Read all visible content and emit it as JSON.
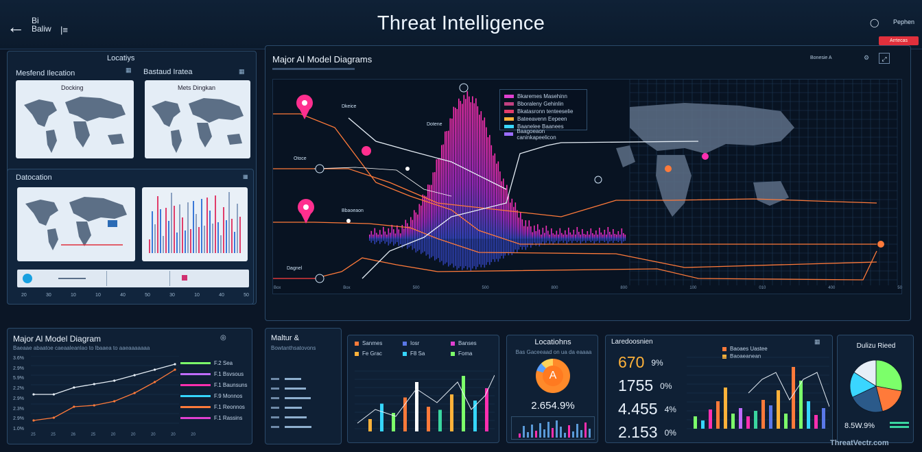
{
  "header": {
    "logo_line1": "Bi",
    "logo_line2": "Baliw",
    "title": "Threat Intelligence",
    "right_label": "Pephen",
    "badge": "Arrtecas"
  },
  "left": {
    "section_title": "Locatiys",
    "card1_title": "Mesfend Ilecation",
    "card1_map_label": "Docking",
    "card2_title": "Bastaud Iratea",
    "card2_map_label": "Mets Dingkan",
    "dislocation_title": "Datocation",
    "timeline": [
      "20",
      "30",
      "10",
      "10",
      "40",
      "50",
      "30",
      "10",
      "40",
      "50"
    ]
  },
  "main": {
    "title": "Major Al Model Diagrams",
    "controls": "Bonesie A",
    "node_labels": [
      "Dkeice",
      "Otoce",
      "Dotene",
      "Bbaoeaon",
      "Dagnel"
    ],
    "legend": [
      "Bkaremes Masehinn",
      "Bboraleny Gehinlin",
      "Bkatasronn tenteeselie",
      "Bateeavenn Eepeen",
      "Baanelee Baanees",
      "Baagoeaon caninkapeelicon"
    ]
  },
  "bottom": {
    "p1_title": "Major Al Model Diagram",
    "p1_subtitle": "Baeaae abaatoe caeaaleanlao to lbaaea to aaeaaaaaaa",
    "p1_y_ticks": [
      "3.6%",
      "2.9%",
      "5.9%",
      "2.2%",
      "2.9%",
      "2.3%",
      "2.9%",
      "1.0%"
    ],
    "p1_legend": [
      "F.2 Sea",
      "F.1 Bsvsous",
      "F.1 Baunsuns",
      "F.9 Monnos",
      "F.1 Reonnos",
      "F.1 Rassins"
    ],
    "p1_x_ticks": [
      "25",
      "25",
      "26",
      "25",
      "20",
      "20",
      "20",
      "20",
      "20"
    ],
    "p2_title": "Maltur &",
    "p2_subtitle": "Bowtanthsatovons",
    "p3_legend": [
      "Sanmes",
      "Iosr",
      "Banses",
      "Fe Grac",
      "F8 Sa",
      "Foma"
    ],
    "p4_title": "Locatiohns",
    "p4_subtitle": "Bas Gaceeaad on ua da eaaaa",
    "p4_value": "2.654.9%",
    "p4_pie_letter": "A",
    "p5_title": "Laredoosnien",
    "p5_numbers": [
      "670",
      "1755",
      "4.455",
      "2.153"
    ],
    "p5_small": [
      "9%",
      "0%",
      "4%",
      "0%"
    ],
    "p5_legend": [
      "Baoaes Uastee",
      "Baoaeanean"
    ],
    "p6_title": "Dulizu Rieed",
    "p6_value": "8.5W.9%"
  },
  "watermark": "ThreatVectr.com",
  "colors": {
    "accent_pink": "#ff2fb0",
    "accent_orange": "#ff7a3a",
    "accent_cyan": "#36d6ff",
    "accent_green": "#7cff6a",
    "badge_red": "#e0303c"
  },
  "chart_data": [
    {
      "type": "line",
      "title": "Major Al Model Diagram",
      "series": [
        {
          "values": [
            5,
            5,
            6,
            6.5,
            7,
            7.8,
            8.6,
            9.4
          ]
        },
        {
          "values": [
            1.2,
            1.6,
            3.2,
            3.4,
            4.0,
            5.2,
            6.8,
            8.6
          ]
        }
      ]
    },
    {
      "type": "bar",
      "values": [
        20,
        45,
        30,
        55,
        80,
        40,
        35,
        60,
        90,
        50,
        70
      ]
    },
    {
      "type": "pie",
      "title": "Dulizu Rieed",
      "values": [
        28,
        18,
        22,
        16,
        16
      ]
    }
  ]
}
